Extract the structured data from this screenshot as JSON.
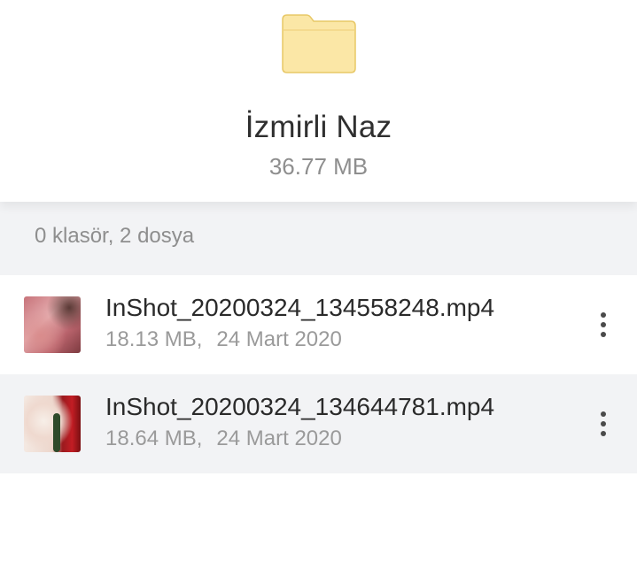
{
  "header": {
    "folder_icon": "folder-icon",
    "folder_name": "İzmirli Naz",
    "folder_size": "36.77 MB"
  },
  "summary": {
    "text": "0 klasör, 2 dosya"
  },
  "files": [
    {
      "name": "InShot_20200324_134558248.mp4",
      "size": "18.13 MB,",
      "date": "24 Mart 2020",
      "thumbnail": "video-thumbnail",
      "menu_icon": "more-vertical-icon"
    },
    {
      "name": "InShot_20200324_134644781.mp4",
      "size": "18.64 MB,",
      "date": "24 Mart 2020",
      "thumbnail": "video-thumbnail",
      "menu_icon": "more-vertical-icon"
    }
  ],
  "colors": {
    "folder_fill": "#fbe7a6",
    "folder_stroke": "#e8c867",
    "alt_row_bg": "#f2f3f5",
    "secondary_text": "#8e8e8e"
  }
}
